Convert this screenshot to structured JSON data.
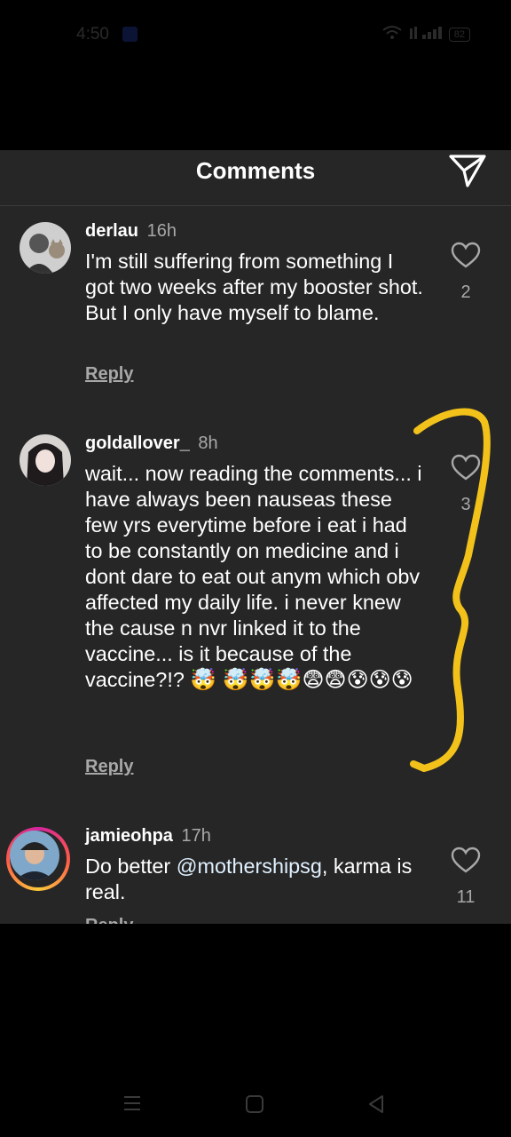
{
  "status_bar": {
    "time": "4:50",
    "battery": "82"
  },
  "header": {
    "title": "Comments"
  },
  "comments": [
    {
      "username": "derlau",
      "time": "16h",
      "text": "I'm still suffering from something I got two weeks after my booster shot. But I only have myself to blame.",
      "likes": "2",
      "reply_label": "Reply"
    },
    {
      "username": "goldallover_",
      "time": "8h",
      "text": "wait... now reading the comments... i have always been nauseas these few yrs everytime before i eat i had to be constantly on medicine and i dont dare to eat out anym which obv affected my daily life. i never knew the cause n nvr linked it to the vaccine... is it because of the vaccine?!?",
      "emojis": "🤯 🤯🤯🤯😨😨😰😰😰",
      "likes": "3",
      "reply_label": "Reply"
    },
    {
      "username": "jamieohpa",
      "time": "17h",
      "text_prefix": "Do better ",
      "mention": "@mothershipsg",
      "text_suffix": ", karma is real.",
      "likes": "11",
      "reply_label": "Reply"
    }
  ],
  "colors": {
    "background": "#262626",
    "annotation": "#f2c21b",
    "secondary_text": "#a8a8a8"
  },
  "icons": [
    "send-icon",
    "heart-icon",
    "menu-icon",
    "home-icon",
    "back-icon"
  ]
}
